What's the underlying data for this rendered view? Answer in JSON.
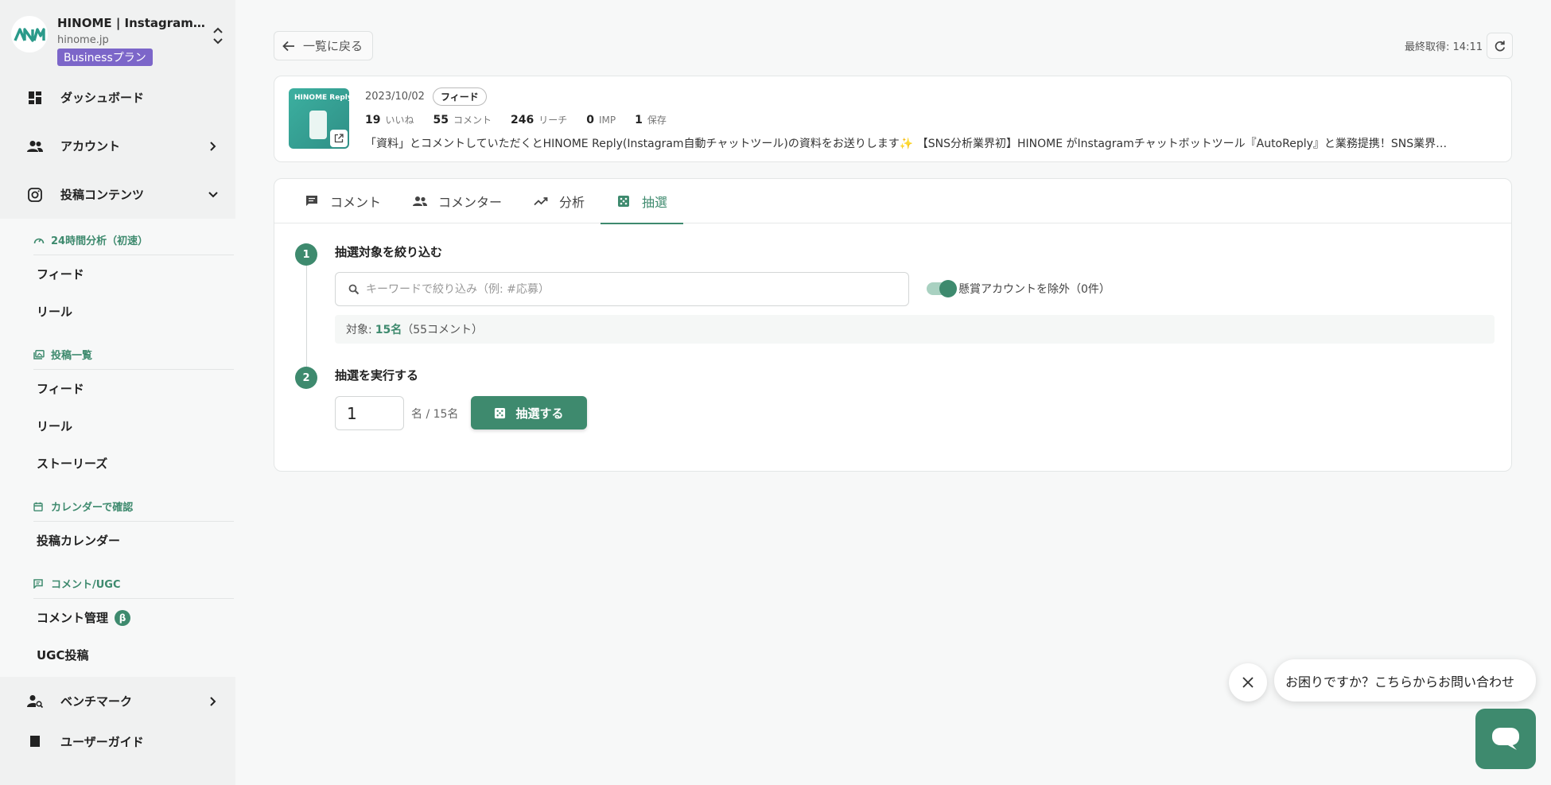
{
  "workspace": {
    "name": "HINOME | Instagram分析…",
    "domain": "hinome.jp",
    "plan": "Businessプラン"
  },
  "nav": {
    "dashboard": "ダッシュボード",
    "account": "アカウント",
    "posts": "投稿コンテンツ",
    "benchmark": "ベンチマーク",
    "cutoff": "ユーザーガイド"
  },
  "subnav": {
    "section_24h": "24時間分析（初速）",
    "section_24h_items": [
      "フィード",
      "リール"
    ],
    "section_list": "投稿一覧",
    "section_list_items": [
      "フィード",
      "リール",
      "ストーリーズ"
    ],
    "section_calendar": "カレンダーで確認",
    "section_calendar_items": [
      "投稿カレンダー"
    ],
    "section_comment": "コメント/UGC",
    "comment_manage": "コメント管理",
    "beta": "β",
    "ugc": "UGC投稿"
  },
  "toolbar": {
    "back_label": "一覧に戻る",
    "last_fetch": "最終取得: 14:11"
  },
  "post": {
    "thumb_text": "HINOME Reply",
    "date": "2023/10/02",
    "type": "フィード",
    "stats": [
      {
        "value": "19",
        "label": "いいね"
      },
      {
        "value": "55",
        "label": "コメント"
      },
      {
        "value": "246",
        "label": "リーチ"
      },
      {
        "value": "0",
        "label": "IMP"
      },
      {
        "value": "1",
        "label": "保存"
      }
    ],
    "caption": "「資料」とコメントしていただくとHINOME Reply(Instagram自動チャットツール)の資料をお送りします✨ 【SNS分析業界初】HINOME がInstagramチャットボットツール『AutoReply』と業務提携！SNS業界…"
  },
  "tabs": [
    {
      "label": "コメント",
      "icon": "comment-icon"
    },
    {
      "label": "コメンター",
      "icon": "people-icon"
    },
    {
      "label": "分析",
      "icon": "trend-icon"
    },
    {
      "label": "抽選",
      "icon": "dice-icon"
    }
  ],
  "active_tab": "抽選",
  "lottery": {
    "step1_num": "1",
    "step1_title": "抽選対象を絞り込む",
    "search_placeholder": "キーワードで絞り込み（例: #応募）",
    "exclude_label": "懸賞アカウントを除外（0件）",
    "exclude_on": true,
    "target_prefix": "対象:",
    "target_count": "15名",
    "target_suffix": "（55コメント）",
    "step2_num": "2",
    "step2_title": "抽選を実行する",
    "count_value": "1",
    "count_suffix": "名 / 15名",
    "draw_label": "抽選する"
  },
  "help": {
    "message": "お困りですか？こちらからお問い合わせ"
  },
  "colors": {
    "accent": "#3e8a6e",
    "plan_badge": "#7c66c9"
  }
}
